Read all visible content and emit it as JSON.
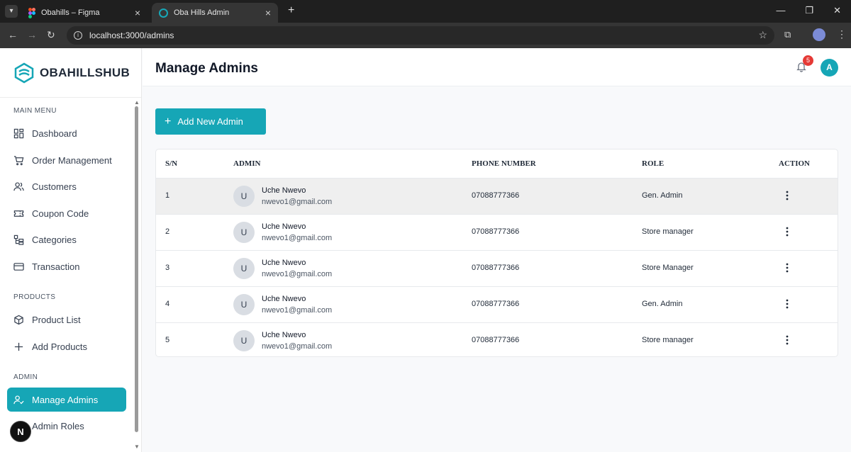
{
  "browser": {
    "tabs": [
      {
        "title": "Obahills – Figma",
        "active": false
      },
      {
        "title": "Oba Hills Admin",
        "active": true
      }
    ],
    "url": "localhost:3000/admins"
  },
  "brand": {
    "name": "OBAHILLSHUB",
    "accent": "#16a6b6"
  },
  "sidebar": {
    "main_menu_label": "MAIN MENU",
    "main_menu": [
      {
        "label": "Dashboard",
        "icon": "dashboard-icon"
      },
      {
        "label": "Order Management",
        "icon": "cart-icon"
      },
      {
        "label": "Customers",
        "icon": "users-icon"
      },
      {
        "label": "Coupon Code",
        "icon": "ticket-icon"
      },
      {
        "label": "Categories",
        "icon": "categories-icon"
      },
      {
        "label": "Transaction",
        "icon": "card-icon"
      }
    ],
    "products_label": "PRODUCTS",
    "products": [
      {
        "label": "Product List",
        "icon": "box-icon"
      },
      {
        "label": "Add Products",
        "icon": "plus-icon"
      }
    ],
    "admin_label": "ADMIN",
    "admin": [
      {
        "label": "Manage Admins",
        "icon": "user-check-icon",
        "active": true
      },
      {
        "label": "Admin Roles",
        "icon": "shield-icon"
      }
    ],
    "dev_badge": "N"
  },
  "header": {
    "title": "Manage Admins",
    "notifications": "5",
    "avatar_initial": "A"
  },
  "add_button": {
    "label": "Add New Admin"
  },
  "table": {
    "columns": {
      "sn": "S/N",
      "admin": "ADMIN",
      "phone": "PHONE NUMBER",
      "role": "ROLE",
      "action": "ACTION"
    },
    "rows": [
      {
        "sn": "1",
        "initial": "U",
        "name": "Uche Nwevo",
        "email": "nwevo1@gmail.com",
        "phone": "07088777366",
        "role": "Gen. Admin",
        "highlight": true
      },
      {
        "sn": "2",
        "initial": "U",
        "name": "Uche Nwevo",
        "email": "nwevo1@gmail.com",
        "phone": "07088777366",
        "role": "Store manager"
      },
      {
        "sn": "3",
        "initial": "U",
        "name": "Uche Nwevo",
        "email": "nwevo1@gmail.com",
        "phone": "07088777366",
        "role": "Store Manager"
      },
      {
        "sn": "4",
        "initial": "U",
        "name": "Uche Nwevo",
        "email": "nwevo1@gmail.com",
        "phone": "07088777366",
        "role": "Gen. Admin"
      },
      {
        "sn": "5",
        "initial": "U",
        "name": "Uche Nwevo",
        "email": "nwevo1@gmail.com",
        "phone": "07088777366",
        "role": "Store manager"
      }
    ]
  }
}
